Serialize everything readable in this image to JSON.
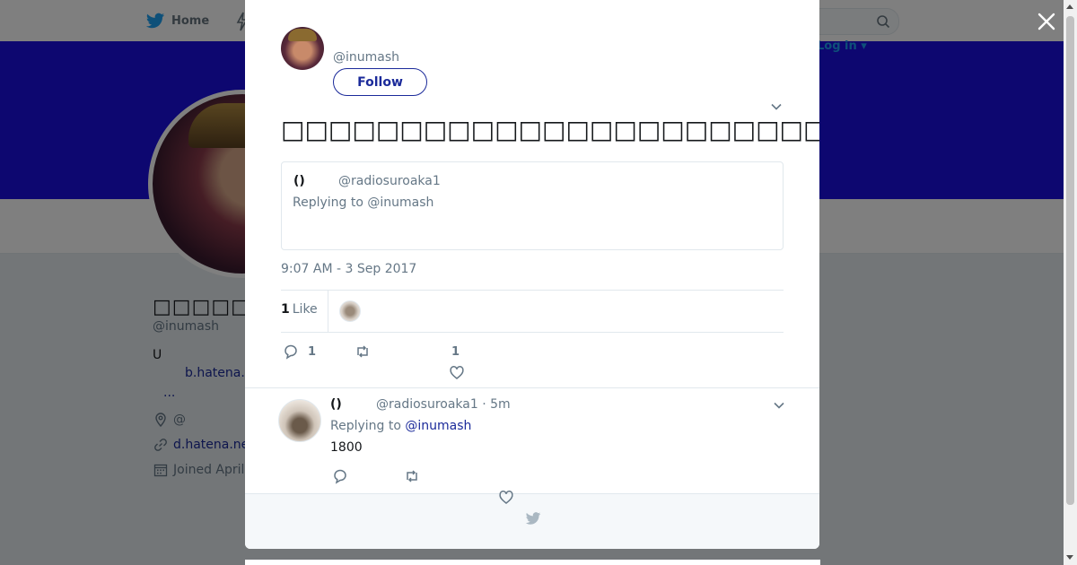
{
  "topbar": {
    "home_label": "Home",
    "login_label": "Log in",
    "icons": [
      "twitter-bird-icon",
      "bolt-icon",
      "search-icon"
    ]
  },
  "colors": {
    "banner": "#1a0ee0",
    "link": "#1b2a9a",
    "secondary_text": "#657786"
  },
  "profile": {
    "name": "□□□□□□□□",
    "handle": "@inumash",
    "bio": "U",
    "bio_link": "b.hatena.",
    "bio_more": "...",
    "location": "@",
    "website": "d.hatena.ne",
    "joined": "Joined April"
  },
  "modal": {
    "close_label": "×",
    "author_handle": "@inumash",
    "follow_label": "Follow",
    "tweet_text": "□□□□□□□□□□□□□□□□□□□□□□□□□□□□□□□□",
    "quoted": {
      "name": "()",
      "handle": "@radiosuroaka1",
      "replying_to": "Replying to @inumash"
    },
    "timestamp": "9:07 AM - 3 Sep 2017",
    "stats": {
      "likes_count": "1",
      "likes_label": "Like"
    },
    "actions": {
      "reply_count": "1",
      "retweet_count": "",
      "like_count": "1"
    },
    "reply": {
      "name": "()",
      "handle_time": "@radiosuroaka1 · 5m",
      "replying_prefix": "Replying to ",
      "replying_handle": "@inumash",
      "text": "1800"
    }
  }
}
